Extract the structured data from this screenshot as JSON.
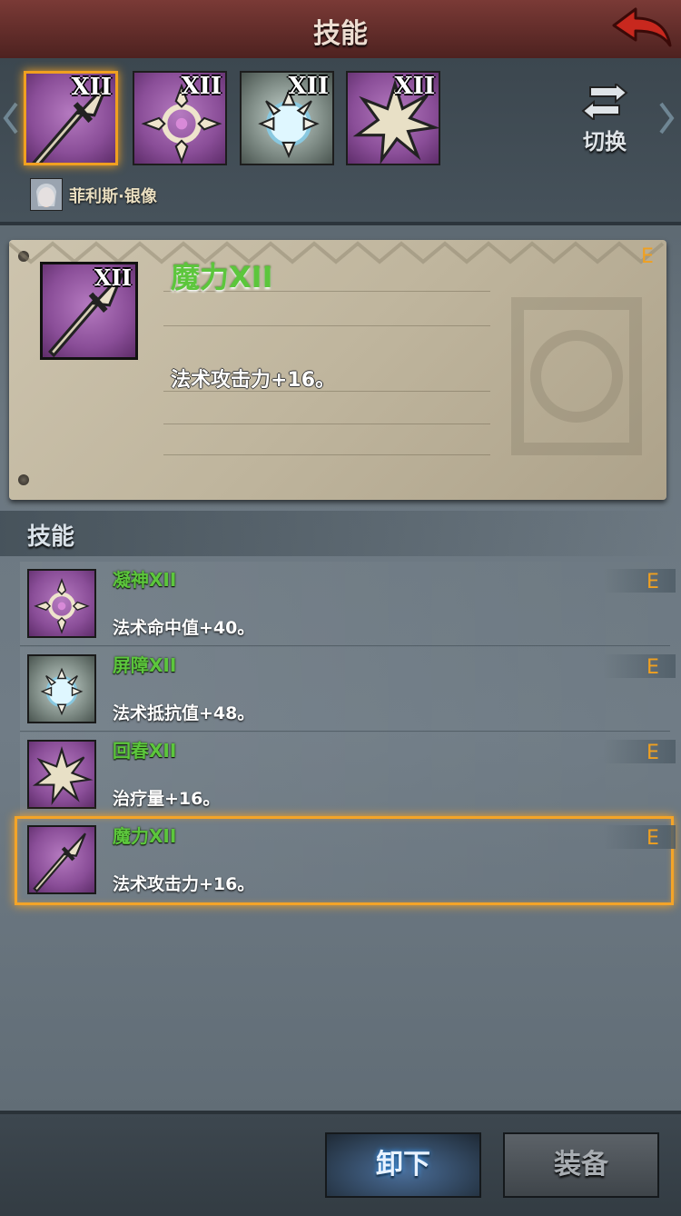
{
  "header": {
    "title": "技能"
  },
  "switch_label": "切换",
  "hero": {
    "name": "菲利斯·银像"
  },
  "top_slots": [
    {
      "level": "XII",
      "icon": "staff-icon",
      "selected": true
    },
    {
      "level": "XII",
      "icon": "focus-cross-icon",
      "selected": false
    },
    {
      "level": "XII",
      "icon": "barrier-burst-icon",
      "selected": false
    },
    {
      "level": "XII",
      "icon": "rejuvenation-burst-icon",
      "selected": false
    }
  ],
  "detail": {
    "icon_level": "XII",
    "title": "魔力XII",
    "description": "法术攻击力+16。",
    "grade": "E"
  },
  "list": {
    "section_title": "技能",
    "items": [
      {
        "name": "凝神XII",
        "description": "法术命中值+40。",
        "grade": "E",
        "icon": "focus-cross-icon"
      },
      {
        "name": "屏障XII",
        "description": "法术抵抗值+48。",
        "grade": "E",
        "icon": "barrier-burst-icon"
      },
      {
        "name": "回春XII",
        "description": "治疗量+16。",
        "grade": "E",
        "icon": "rejuvenation-burst-icon"
      },
      {
        "name": "魔力XII",
        "description": "法术攻击力+16。",
        "grade": "E",
        "icon": "staff-icon",
        "selected": true
      }
    ]
  },
  "footer": {
    "unequip_label": "卸下",
    "equip_label": "装备"
  },
  "colors": {
    "accent_orange": "#f0a020",
    "name_green": "#5cc63c",
    "header_red": "#7a3a36"
  }
}
